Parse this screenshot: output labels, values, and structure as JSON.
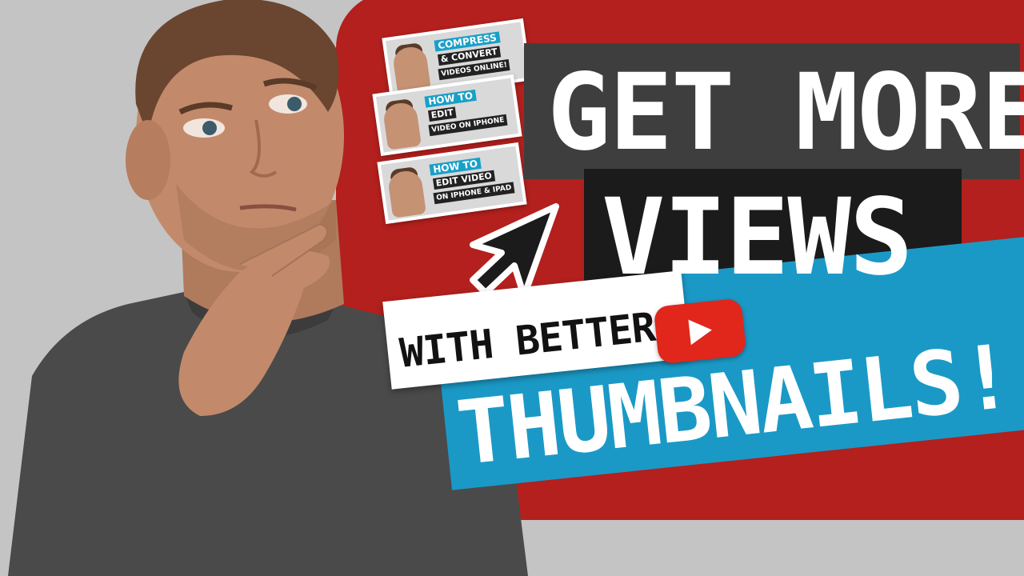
{
  "headline": {
    "line1": "GET MORE",
    "line2": "VIEWS",
    "line3": "WITH BETTER",
    "line4": "THUMBNAILS!"
  },
  "thumbnails": [
    {
      "top_label": "COMPRESS",
      "mid_label": "& CONVERT",
      "bottom_label": "VIDEOS ONLINE!"
    },
    {
      "top_label": "HOW TO",
      "mid_label": "EDIT",
      "bottom_label": "VIDEO ON IPHONE"
    },
    {
      "top_label": "HOW TO",
      "mid_label": "EDIT VIDEO",
      "bottom_label": "ON IPHONE & IPAD"
    }
  ],
  "icons": {
    "youtube": "youtube-play-icon",
    "cursor": "mouse-pointer-icon"
  },
  "colors": {
    "red_background": "#b3201d",
    "dark_box": "#3e3e3e",
    "black_box": "#1b1b1b",
    "blue_box": "#1b99c6",
    "youtube_red": "#e1261c"
  }
}
